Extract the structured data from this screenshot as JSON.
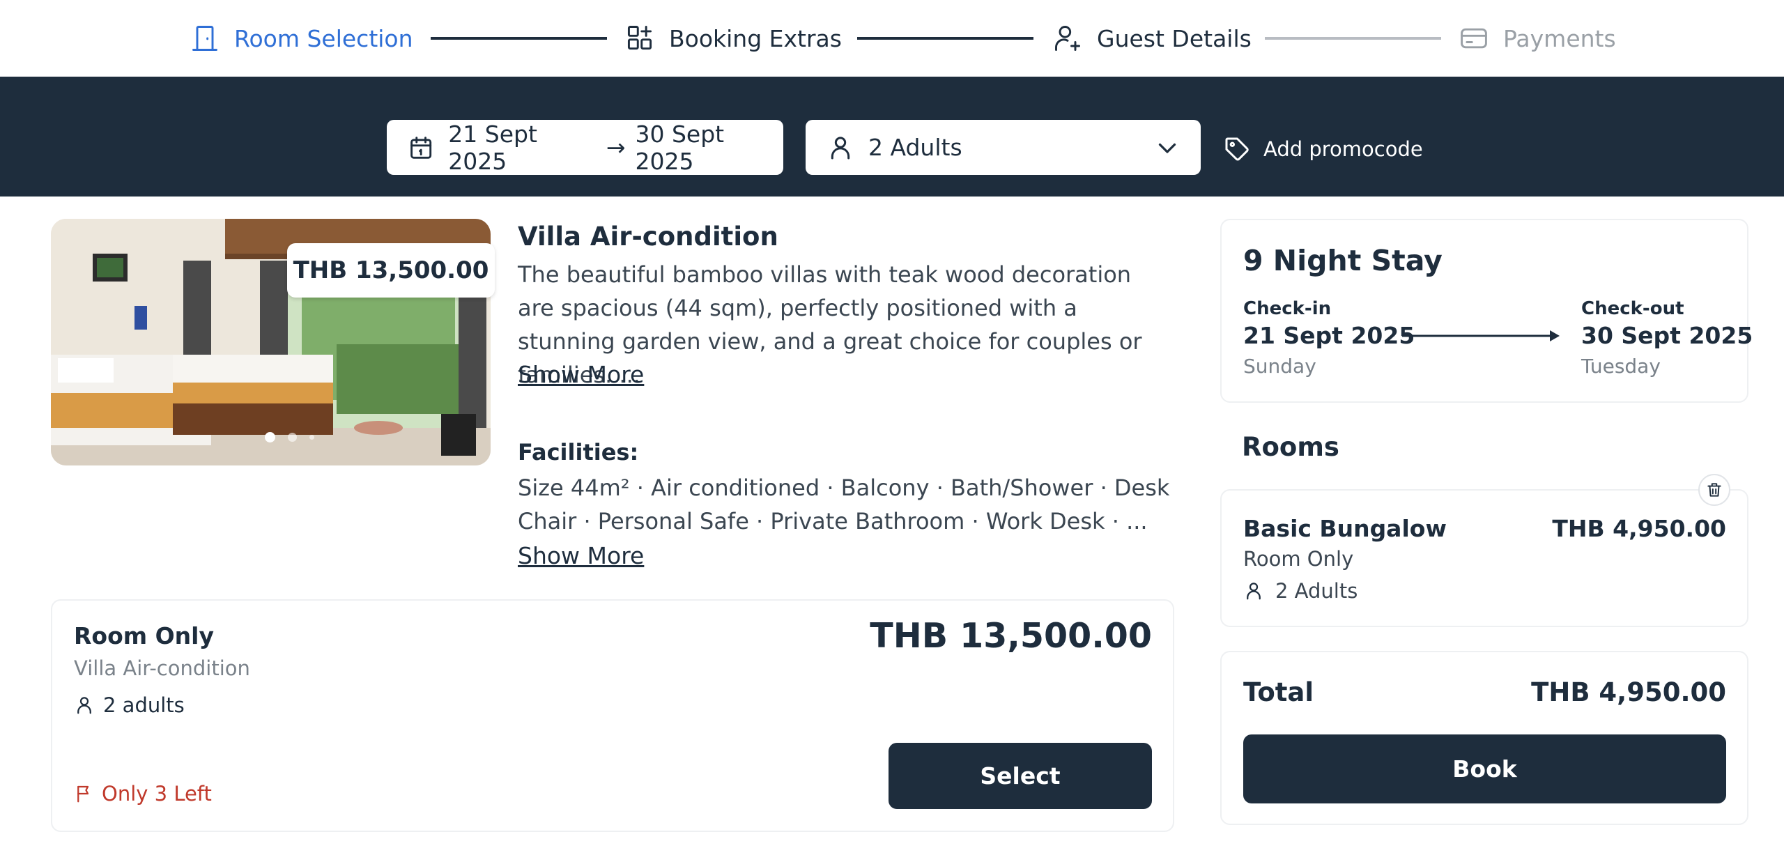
{
  "stepper": {
    "steps": [
      {
        "label": "Room Selection",
        "icon": "door-icon",
        "state": "active"
      },
      {
        "label": "Booking Extras",
        "icon": "grid-plus-icon",
        "state": "done"
      },
      {
        "label": "Guest Details",
        "icon": "user-plus-icon",
        "state": "done"
      },
      {
        "label": "Payments",
        "icon": "credit-card-icon",
        "state": "todo"
      }
    ]
  },
  "search": {
    "check_in": "21 Sept 2025",
    "arrow": "→",
    "check_out": "30 Sept 2025",
    "guests": "2 Adults",
    "promo_label": "Add promocode"
  },
  "room": {
    "price_tag": "THB 13,500.00",
    "title": "Villa Air-condition",
    "description": "The beautiful bamboo villas with teak wood decoration are spacious (44 sqm), perfectly positioned with a stunning garden view, and a great choice for couples or families. ...",
    "show_more": "Show More",
    "facilities_title": "Facilities:",
    "facilities": "Size 44m² · Air conditioned · Balcony · Bath/Shower · Desk Chair · Personal Safe · Private Bathroom · Work Desk · ...",
    "facilities_show_more": "Show More"
  },
  "rate": {
    "name": "Room Only",
    "subtitle": "Villa Air-condition",
    "guests": "2 adults",
    "price": "THB 13,500.00",
    "availability": "Only 3 Left",
    "select_label": "Select"
  },
  "summary": {
    "stay_title": "9 Night Stay",
    "check_in_label": "Check-in",
    "check_in_date": "21 Sept 2025",
    "check_in_day": "Sunday",
    "check_out_label": "Check-out",
    "check_out_date": "30 Sept 2025",
    "check_out_day": "Tuesday",
    "rooms_heading": "Rooms",
    "selected_room": {
      "name": "Basic Bungalow",
      "price": "THB 4,950.00",
      "plan": "Room Only",
      "guests": "2 Adults"
    },
    "total_label": "Total",
    "total_value": "THB 4,950.00",
    "book_label": "Book"
  },
  "colors": {
    "navy": "#1e2d3d",
    "active_blue": "#2f6fd6",
    "warning_red": "#c0392b"
  }
}
